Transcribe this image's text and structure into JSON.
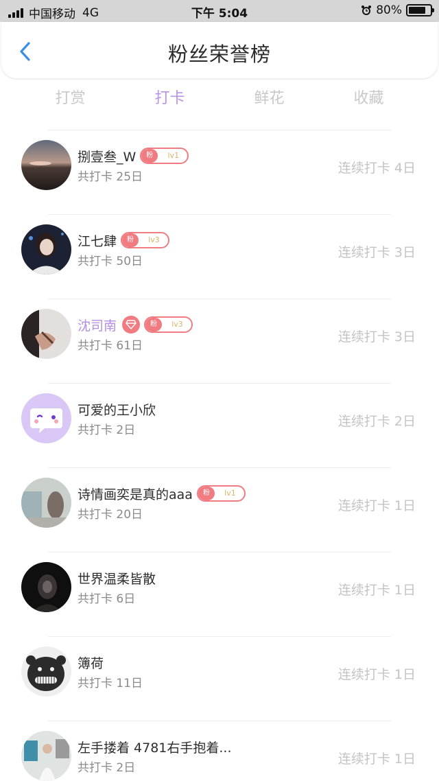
{
  "status_bar": {
    "carrier": "中国移动",
    "network": "4G",
    "time": "下午 5:04",
    "battery_text": "80%",
    "battery_level": 0.8
  },
  "header": {
    "title": "粉丝荣誉榜",
    "back_icon": "chevron-left-icon",
    "accent_color": "#3a8ee6"
  },
  "tabs": [
    {
      "label": "打赏",
      "active": false
    },
    {
      "label": "打卡",
      "active": true
    },
    {
      "label": "鲜花",
      "active": false
    },
    {
      "label": "收藏",
      "active": false
    }
  ],
  "colors": {
    "active_tab": "#b694e6",
    "badge": "#f07c81",
    "vip_name": "#b48ee4"
  },
  "fan_badge_label": "粉",
  "fans": [
    {
      "name": "捌壹叁_W",
      "level": "lv1",
      "total": "共打卡 25日",
      "streak": "连续打卡 4日",
      "vip": false,
      "avatar": "sunset-landscape"
    },
    {
      "name": "江七肆",
      "level": "lv3",
      "total": "共打卡 50日",
      "streak": "连续打卡 3日",
      "vip": false,
      "avatar": "woman-portrait"
    },
    {
      "name": "沈司南",
      "level": "lv3",
      "total": "共打卡 61日",
      "streak": "连续打卡 3日",
      "vip": true,
      "avatar": "hand-photo"
    },
    {
      "name": "可爱的王小欣",
      "level": null,
      "total": "共打卡 2日",
      "streak": "连续打卡 2日",
      "vip": false,
      "avatar": "default-chat-face"
    },
    {
      "name": "诗情画奕是真的aaa",
      "level": "lv1",
      "total": "共打卡 20日",
      "streak": "连续打卡 1日",
      "vip": false,
      "avatar": "blurry-room"
    },
    {
      "name": "世界温柔皆散",
      "level": null,
      "total": "共打卡 6日",
      "streak": "连续打卡 1日",
      "vip": false,
      "avatar": "dark-portrait"
    },
    {
      "name": "簿荷",
      "level": null,
      "total": "共打卡 11日",
      "streak": "连续打卡 1日",
      "vip": false,
      "avatar": "black-cartoon-face"
    },
    {
      "name": "左手搂着 4781右手抱着...",
      "level": null,
      "total": "共打卡 2日",
      "streak": "连续打卡 1日",
      "vip": false,
      "avatar": "person-indoor"
    }
  ]
}
